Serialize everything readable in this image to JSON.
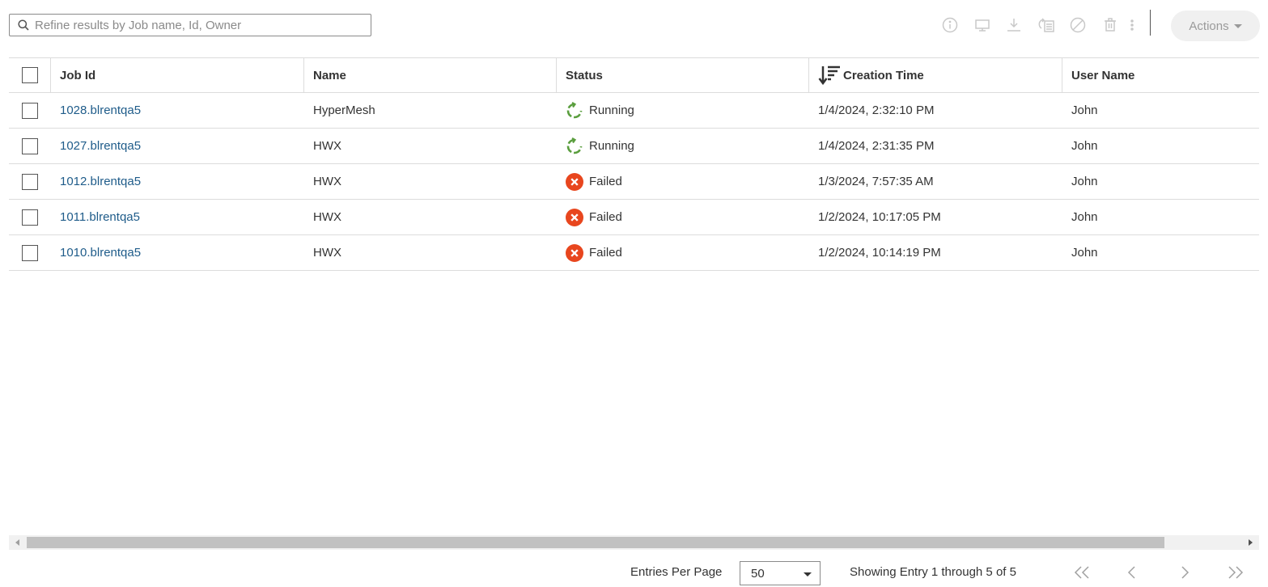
{
  "search": {
    "placeholder": "Refine results by Job name, Id, Owner"
  },
  "toolbar": {
    "icons": [
      "info-icon",
      "monitor-icon",
      "download-icon",
      "copy-icon",
      "cancel-icon",
      "delete-icon",
      "more-icon"
    ],
    "actions_label": "Actions"
  },
  "table": {
    "columns": [
      "Job Id",
      "Name",
      "Status",
      "Creation Time",
      "User Name"
    ],
    "sorted_column": "Creation Time",
    "sort_direction": "descending",
    "rows": [
      {
        "job_id": "1028.blrentqa5",
        "name": "HyperMesh",
        "status": "Running",
        "created": "1/4/2024, 2:32:10 PM",
        "user": "John"
      },
      {
        "job_id": "1027.blrentqa5",
        "name": "HWX",
        "status": "Running",
        "created": "1/4/2024, 2:31:35 PM",
        "user": "John"
      },
      {
        "job_id": "1012.blrentqa5",
        "name": "HWX",
        "status": "Failed",
        "created": "1/3/2024, 7:57:35 AM",
        "user": "John"
      },
      {
        "job_id": "1011.blrentqa5",
        "name": "HWX",
        "status": "Failed",
        "created": "1/2/2024, 10:17:05 PM",
        "user": "John"
      },
      {
        "job_id": "1010.blrentqa5",
        "name": "HWX",
        "status": "Failed",
        "created": "1/2/2024, 10:14:19 PM",
        "user": "John"
      }
    ]
  },
  "status_colors": {
    "Running": "#5a9e3e",
    "Failed": "#e8461e"
  },
  "pager": {
    "entries_label": "Entries Per Page",
    "per_page": "50",
    "showing": "Showing Entry 1 through 5 of 5"
  }
}
